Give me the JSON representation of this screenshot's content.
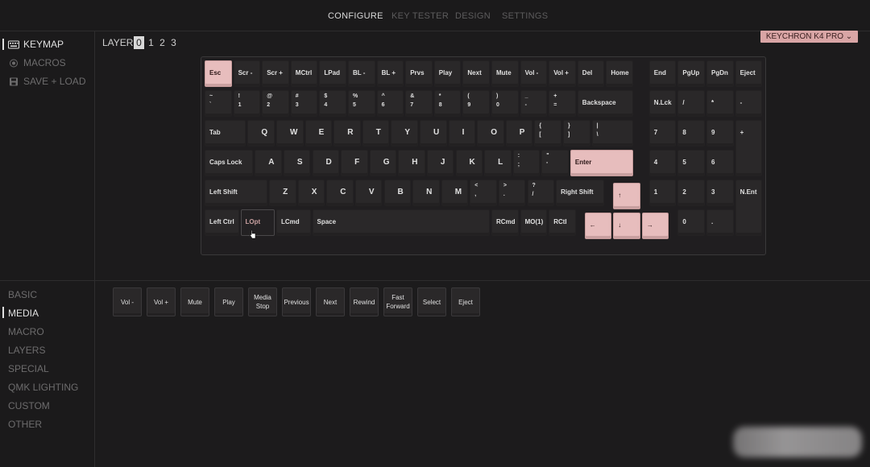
{
  "nav": {
    "tabs": [
      "CONFIGURE",
      "KEY TESTER",
      "DESIGN",
      "SETTINGS"
    ],
    "active": "CONFIGURE"
  },
  "sidebar": {
    "items": [
      {
        "label": "KEYMAP",
        "icon": "keyboard-icon",
        "active": true
      },
      {
        "label": "MACROS",
        "icon": "record-icon"
      },
      {
        "label": "SAVE + LOAD",
        "icon": "floppy-disk-icon"
      }
    ]
  },
  "layers": {
    "label": "LAYER",
    "numbers": [
      "0",
      "1",
      "2",
      "3"
    ],
    "active": "0"
  },
  "keyboard_name": "KEYCHRON K4 PRO",
  "keys": {
    "r0": [
      "Esc",
      "Scr -",
      "Scr +",
      "MCtrl",
      "LPad",
      "BL -",
      "BL +",
      "Prvs",
      "Play",
      "Next",
      "Mute",
      "Vol -",
      "Vol +",
      "Del",
      "Home",
      "End",
      "PgUp",
      "PgDn",
      "Eject"
    ],
    "r1": [
      [
        "~",
        "`"
      ],
      [
        "!",
        "1"
      ],
      [
        "@",
        "2"
      ],
      [
        "#",
        "3"
      ],
      [
        "$",
        "4"
      ],
      [
        "%",
        "5"
      ],
      [
        "^",
        "6"
      ],
      [
        "&",
        "7"
      ],
      [
        "*",
        "8"
      ],
      [
        "(",
        "9"
      ],
      [
        ")",
        "0"
      ],
      [
        "_",
        "-"
      ],
      [
        "+",
        "="
      ],
      "Backspace",
      "N.Lck",
      "/",
      "*",
      "-"
    ],
    "r2": [
      "Tab",
      "Q",
      "W",
      "E",
      "R",
      "T",
      "Y",
      "U",
      "I",
      "O",
      "P",
      [
        "{",
        "["
      ],
      [
        "}",
        "]"
      ],
      [
        "|",
        "\\"
      ],
      "7",
      "8",
      "9",
      "+"
    ],
    "r3": [
      "Caps Lock",
      "A",
      "S",
      "D",
      "F",
      "G",
      "H",
      "J",
      "K",
      "L",
      [
        ":",
        ";"
      ],
      [
        "\"",
        "'"
      ],
      "Enter",
      "4",
      "5",
      "6"
    ],
    "r4": [
      "Left Shift",
      "Z",
      "X",
      "C",
      "V",
      "B",
      "N",
      "M",
      [
        "<",
        ","
      ],
      [
        ">",
        "."
      ],
      [
        "?",
        "/"
      ],
      "Right Shift",
      "↑",
      "1",
      "2",
      "3",
      "N.Ent"
    ],
    "r5": [
      "Left Ctrl",
      "LOpt",
      "LCmd",
      "Space",
      "RCmd",
      "MO(1)",
      "RCtl",
      "←",
      "↓",
      "→",
      "0",
      "."
    ]
  },
  "categories": {
    "items": [
      "BASIC",
      "MEDIA",
      "MACRO",
      "LAYERS",
      "SPECIAL",
      "QMK LIGHTING",
      "CUSTOM",
      "OTHER"
    ],
    "active": "MEDIA"
  },
  "media_keys": [
    "Vol -",
    "Vol +",
    "Mute",
    "Play",
    "Media Stop",
    "Previous",
    "Next",
    "Rewind",
    "Fast Forward",
    "Select",
    "Eject"
  ],
  "colors": {
    "accent": "#e7bdbd",
    "pill": "#d9a5a5",
    "bg": "#1c1b1c",
    "key": "#2a2829"
  }
}
